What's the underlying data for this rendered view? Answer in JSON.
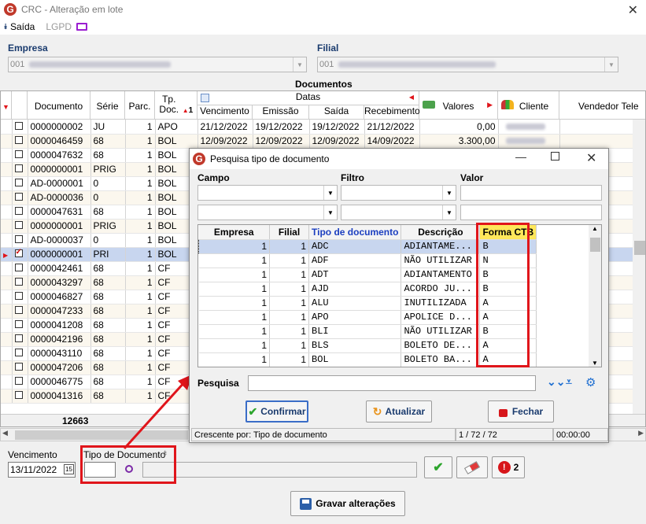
{
  "window": {
    "title": "CRC - Alteração em lote",
    "close": "✕"
  },
  "toolbar": {
    "exit": "Saída",
    "lgpd": "LGPD"
  },
  "filters": {
    "empresa_label": "Empresa",
    "empresa_value": "001",
    "filial_label": "Filial",
    "filial_value": "001"
  },
  "grid": {
    "section_title": "Documentos",
    "headers": {
      "documento": "Documento",
      "serie": "Série",
      "parc": "Parc.",
      "tp_doc": "Tp. Doc.",
      "datas": "Datas",
      "vencimento": "Vencimento",
      "emissao": "Emissão",
      "saida": "Saída",
      "recebimento": "Recebimento",
      "valores": "Valores",
      "cliente": "Cliente",
      "vendedor": "Vendedor Tele"
    },
    "rows": [
      {
        "doc": "0000000002",
        "serie": "JU",
        "parc": "1",
        "tp": "APO",
        "venc": "21/12/2022",
        "emis": "19/12/2022",
        "saida": "19/12/2022",
        "rec": "21/12/2022",
        "valor": "0,00"
      },
      {
        "doc": "0000046459",
        "serie": "68",
        "parc": "1",
        "tp": "BOL",
        "venc": "12/09/2022",
        "emis": "12/09/2022",
        "saida": "12/09/2022",
        "rec": "14/09/2022",
        "valor": "3.300,00"
      },
      {
        "doc": "0000047632",
        "serie": "68",
        "parc": "1",
        "tp": "BOL"
      },
      {
        "doc": "0000000001",
        "serie": "PRIG",
        "parc": "1",
        "tp": "BOL"
      },
      {
        "doc": "AD-0000001",
        "serie": "0",
        "parc": "1",
        "tp": "BOL"
      },
      {
        "doc": "AD-0000036",
        "serie": "0",
        "parc": "1",
        "tp": "BOL"
      },
      {
        "doc": "0000047631",
        "serie": "68",
        "parc": "1",
        "tp": "BOL"
      },
      {
        "doc": "0000000001",
        "serie": "PRIG",
        "parc": "1",
        "tp": "BOL"
      },
      {
        "doc": "AD-0000037",
        "serie": "0",
        "parc": "1",
        "tp": "BOL"
      },
      {
        "doc": "0000000001",
        "serie": "PRI",
        "parc": "1",
        "tp": "BOL"
      },
      {
        "doc": "0000042461",
        "serie": "68",
        "parc": "1",
        "tp": "CF"
      },
      {
        "doc": "0000043297",
        "serie": "68",
        "parc": "1",
        "tp": "CF"
      },
      {
        "doc": "0000046827",
        "serie": "68",
        "parc": "1",
        "tp": "CF"
      },
      {
        "doc": "0000047233",
        "serie": "68",
        "parc": "1",
        "tp": "CF"
      },
      {
        "doc": "0000041208",
        "serie": "68",
        "parc": "1",
        "tp": "CF"
      },
      {
        "doc": "0000042196",
        "serie": "68",
        "parc": "1",
        "tp": "CF"
      },
      {
        "doc": "0000043110",
        "serie": "68",
        "parc": "1",
        "tp": "CF"
      },
      {
        "doc": "0000047206",
        "serie": "68",
        "parc": "1",
        "tp": "CF"
      },
      {
        "doc": "0000046775",
        "serie": "68",
        "parc": "1",
        "tp": "CF"
      },
      {
        "doc": "0000041316",
        "serie": "68",
        "parc": "1",
        "tp": "CF"
      }
    ],
    "total": "12663",
    "sort_number": "1"
  },
  "bottom": {
    "venc_label": "Vencimento",
    "venc_value": "13/11/2022",
    "tipo_label": "Tipo de Documento",
    "badge_count": "2",
    "save_label": "Gravar alterações"
  },
  "dialog": {
    "title": "Pesquisa tipo de documento",
    "campo": "Campo",
    "filtro": "Filtro",
    "valor": "Valor",
    "headers": {
      "empresa": "Empresa",
      "filial": "Filial",
      "tipo": "Tipo de documento",
      "descricao": "Descrição",
      "forma": "Forma CTB"
    },
    "rows": [
      {
        "emp": "1",
        "fil": "1",
        "tipo": "ADC",
        "desc": "ADIANTAME...",
        "forma": "B"
      },
      {
        "emp": "1",
        "fil": "1",
        "tipo": "ADF",
        "desc": "NÃO UTILIZAR",
        "forma": "N"
      },
      {
        "emp": "1",
        "fil": "1",
        "tipo": "ADT",
        "desc": "ADIANTAMENTO",
        "forma": "B"
      },
      {
        "emp": "1",
        "fil": "1",
        "tipo": "AJD",
        "desc": "ACORDO JU...",
        "forma": "B"
      },
      {
        "emp": "1",
        "fil": "1",
        "tipo": "ALU",
        "desc": "INUTILIZADA",
        "forma": "A"
      },
      {
        "emp": "1",
        "fil": "1",
        "tipo": "APO",
        "desc": "APOLICE D...",
        "forma": "A"
      },
      {
        "emp": "1",
        "fil": "1",
        "tipo": "BLI",
        "desc": "NÃO UTILIZAR",
        "forma": "B"
      },
      {
        "emp": "1",
        "fil": "1",
        "tipo": "BLS",
        "desc": "BOLETO DE...",
        "forma": "A"
      },
      {
        "emp": "1",
        "fil": "1",
        "tipo": "BOL",
        "desc": "BOLETO BA...",
        "forma": "A"
      }
    ],
    "search_label": "Pesquisa",
    "confirm": "Confirmar",
    "update": "Atualizar",
    "close": "Fechar",
    "status_sort": "Crescente por: Tipo de documento",
    "status_count": "1 / 72 / 72",
    "status_time": "00:00:00"
  },
  "colors": {
    "accent": "#1a3b6e",
    "highlight": "#e0151b",
    "selected": "#c8d6ef"
  }
}
